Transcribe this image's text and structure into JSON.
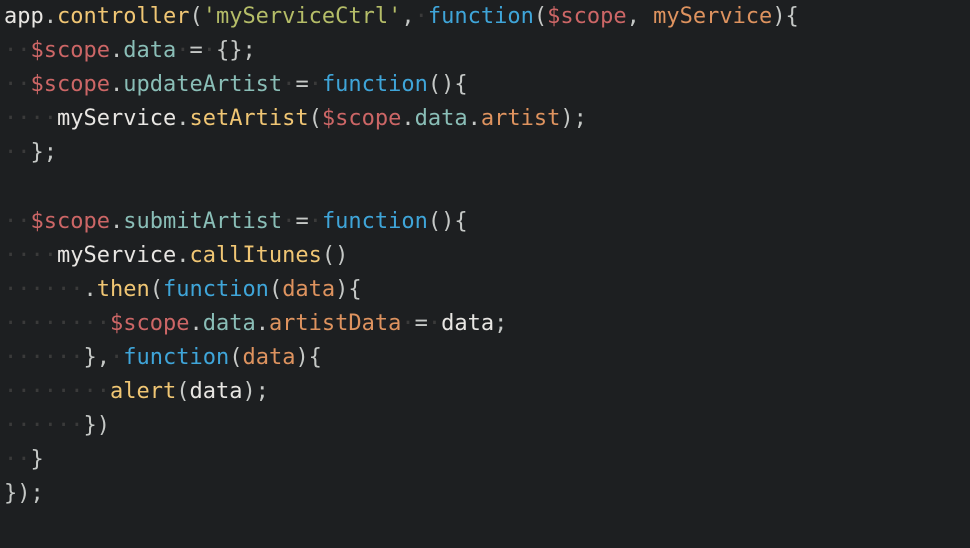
{
  "code": {
    "lines": [
      {
        "tokens": [
          {
            "t": "var",
            "v": "app"
          },
          {
            "t": "punc",
            "v": "."
          },
          {
            "t": "fn-y",
            "v": "controller"
          },
          {
            "t": "paren",
            "v": "("
          },
          {
            "t": "str",
            "v": "'myServiceCtrl'"
          },
          {
            "t": "punc",
            "v": ","
          },
          {
            "t": "ws",
            "v": "·"
          },
          {
            "t": "kw",
            "v": "function"
          },
          {
            "t": "paren",
            "v": "("
          },
          {
            "t": "red",
            "v": "$scope"
          },
          {
            "t": "op",
            "v": ", "
          },
          {
            "t": "prop-o",
            "v": "myService"
          },
          {
            "t": "paren",
            "v": "){"
          }
        ]
      },
      {
        "tokens": [
          {
            "t": "ws",
            "v": "··"
          },
          {
            "t": "red",
            "v": "$scope"
          },
          {
            "t": "punc",
            "v": "."
          },
          {
            "t": "prop-g",
            "v": "data"
          },
          {
            "t": "ws",
            "v": "·"
          },
          {
            "t": "op",
            "v": "="
          },
          {
            "t": "ws",
            "v": "·"
          },
          {
            "t": "paren",
            "v": "{};"
          }
        ]
      },
      {
        "tokens": [
          {
            "t": "ws",
            "v": "··"
          },
          {
            "t": "red",
            "v": "$scope"
          },
          {
            "t": "punc",
            "v": "."
          },
          {
            "t": "prop-g",
            "v": "updateArtist"
          },
          {
            "t": "ws",
            "v": "·"
          },
          {
            "t": "op",
            "v": "="
          },
          {
            "t": "ws",
            "v": "·"
          },
          {
            "t": "kw",
            "v": "function"
          },
          {
            "t": "paren",
            "v": "(){"
          }
        ]
      },
      {
        "tokens": [
          {
            "t": "ws",
            "v": "····"
          },
          {
            "t": "var",
            "v": "myService"
          },
          {
            "t": "punc",
            "v": "."
          },
          {
            "t": "fn-y",
            "v": "setArtist"
          },
          {
            "t": "paren",
            "v": "("
          },
          {
            "t": "red",
            "v": "$scope"
          },
          {
            "t": "punc",
            "v": "."
          },
          {
            "t": "prop-g",
            "v": "data"
          },
          {
            "t": "punc",
            "v": "."
          },
          {
            "t": "prop-o",
            "v": "artist"
          },
          {
            "t": "paren",
            "v": ");"
          }
        ]
      },
      {
        "tokens": [
          {
            "t": "ws",
            "v": "··"
          },
          {
            "t": "paren",
            "v": "};"
          }
        ]
      },
      {
        "tokens": []
      },
      {
        "tokens": [
          {
            "t": "ws",
            "v": "··"
          },
          {
            "t": "red",
            "v": "$scope"
          },
          {
            "t": "punc",
            "v": "."
          },
          {
            "t": "prop-g",
            "v": "submitArtist"
          },
          {
            "t": "ws",
            "v": "·"
          },
          {
            "t": "op",
            "v": "="
          },
          {
            "t": "ws",
            "v": "·"
          },
          {
            "t": "kw",
            "v": "function"
          },
          {
            "t": "paren",
            "v": "(){"
          }
        ]
      },
      {
        "tokens": [
          {
            "t": "ws",
            "v": "····"
          },
          {
            "t": "var",
            "v": "myService"
          },
          {
            "t": "punc",
            "v": "."
          },
          {
            "t": "fn-y",
            "v": "callItunes"
          },
          {
            "t": "paren",
            "v": "()"
          }
        ]
      },
      {
        "tokens": [
          {
            "t": "ws",
            "v": "······"
          },
          {
            "t": "punc",
            "v": "."
          },
          {
            "t": "fn-y",
            "v": "then"
          },
          {
            "t": "paren",
            "v": "("
          },
          {
            "t": "kw",
            "v": "function"
          },
          {
            "t": "paren",
            "v": "("
          },
          {
            "t": "prop-o",
            "v": "data"
          },
          {
            "t": "paren",
            "v": "){"
          }
        ]
      },
      {
        "tokens": [
          {
            "t": "ws",
            "v": "········"
          },
          {
            "t": "red",
            "v": "$scope"
          },
          {
            "t": "punc",
            "v": "."
          },
          {
            "t": "prop-g",
            "v": "data"
          },
          {
            "t": "punc",
            "v": "."
          },
          {
            "t": "prop-o",
            "v": "artistData"
          },
          {
            "t": "ws",
            "v": "·"
          },
          {
            "t": "op",
            "v": "="
          },
          {
            "t": "ws",
            "v": "·"
          },
          {
            "t": "var",
            "v": "data"
          },
          {
            "t": "paren",
            "v": ";"
          }
        ]
      },
      {
        "tokens": [
          {
            "t": "ws",
            "v": "······"
          },
          {
            "t": "paren",
            "v": "},"
          },
          {
            "t": "ws",
            "v": "·"
          },
          {
            "t": "kw",
            "v": "function"
          },
          {
            "t": "paren",
            "v": "("
          },
          {
            "t": "prop-o",
            "v": "data"
          },
          {
            "t": "paren",
            "v": "){"
          }
        ]
      },
      {
        "tokens": [
          {
            "t": "ws",
            "v": "········"
          },
          {
            "t": "fn-y",
            "v": "alert"
          },
          {
            "t": "paren",
            "v": "("
          },
          {
            "t": "var",
            "v": "data"
          },
          {
            "t": "paren",
            "v": ");"
          }
        ]
      },
      {
        "tokens": [
          {
            "t": "ws",
            "v": "······"
          },
          {
            "t": "paren",
            "v": "})"
          }
        ]
      },
      {
        "tokens": [
          {
            "t": "ws",
            "v": "··"
          },
          {
            "t": "paren",
            "v": "}"
          }
        ]
      },
      {
        "tokens": [
          {
            "t": "paren",
            "v": "});"
          }
        ]
      }
    ]
  }
}
